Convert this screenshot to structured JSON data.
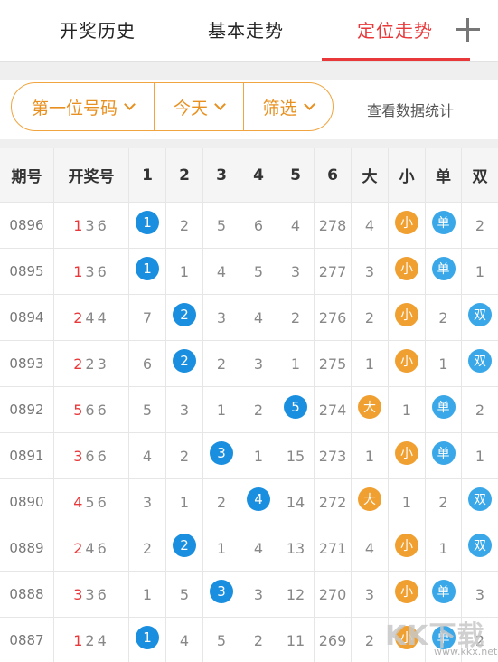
{
  "tabs": [
    {
      "label": "开奖历史",
      "active": false
    },
    {
      "label": "基本走势",
      "active": false
    },
    {
      "label": "定位走势",
      "active": true
    }
  ],
  "filters": {
    "position": "第一位号码",
    "date": "今天",
    "filter": "筛选",
    "stats_link": "查看数据统计"
  },
  "columns": [
    "期号",
    "开奖号",
    "1",
    "2",
    "3",
    "4",
    "5",
    "6",
    "大",
    "小",
    "单",
    "双"
  ],
  "rows": [
    {
      "period": "0896",
      "draw": [
        "1",
        "3",
        "6"
      ],
      "cells": [
        "1",
        "2",
        "5",
        "6",
        "4",
        "278",
        "4",
        "小",
        "单",
        "2"
      ]
    },
    {
      "period": "0895",
      "draw": [
        "1",
        "3",
        "6"
      ],
      "cells": [
        "1",
        "1",
        "4",
        "5",
        "3",
        "277",
        "3",
        "小",
        "单",
        "1"
      ]
    },
    {
      "period": "0894",
      "draw": [
        "2",
        "4",
        "4"
      ],
      "cells": [
        "7",
        "2",
        "3",
        "4",
        "2",
        "276",
        "2",
        "小",
        "2",
        "双"
      ]
    },
    {
      "period": "0893",
      "draw": [
        "2",
        "2",
        "3"
      ],
      "cells": [
        "6",
        "2",
        "2",
        "3",
        "1",
        "275",
        "1",
        "小",
        "1",
        "双"
      ]
    },
    {
      "period": "0892",
      "draw": [
        "5",
        "6",
        "6"
      ],
      "cells": [
        "5",
        "3",
        "1",
        "2",
        "5",
        "274",
        "大",
        "1",
        "单",
        "2"
      ]
    },
    {
      "period": "0891",
      "draw": [
        "3",
        "6",
        "6"
      ],
      "cells": [
        "4",
        "2",
        "3",
        "1",
        "15",
        "273",
        "1",
        "小",
        "单",
        "1"
      ]
    },
    {
      "period": "0890",
      "draw": [
        "4",
        "5",
        "6"
      ],
      "cells": [
        "3",
        "1",
        "2",
        "4",
        "14",
        "272",
        "大",
        "1",
        "2",
        "双"
      ]
    },
    {
      "period": "0889",
      "draw": [
        "2",
        "4",
        "6"
      ],
      "cells": [
        "2",
        "2",
        "1",
        "4",
        "13",
        "271",
        "4",
        "小",
        "1",
        "双"
      ]
    },
    {
      "period": "0888",
      "draw": [
        "3",
        "3",
        "6"
      ],
      "cells": [
        "1",
        "5",
        "3",
        "3",
        "12",
        "270",
        "3",
        "小",
        "单",
        "3"
      ]
    },
    {
      "period": "0887",
      "draw": [
        "1",
        "2",
        "4"
      ],
      "cells": [
        "1",
        "4",
        "5",
        "2",
        "11",
        "269",
        "2",
        "小",
        "单",
        "2"
      ]
    }
  ],
  "highlight": {
    "blue": "#1a8fe0",
    "orange": "#f0a030",
    "sky": "#3aa8e8",
    "accent_red": "#e8383a",
    "filter_orange": "#e8901f"
  },
  "watermark": {
    "text": "KK下载",
    "url": "www.kkx.net"
  }
}
